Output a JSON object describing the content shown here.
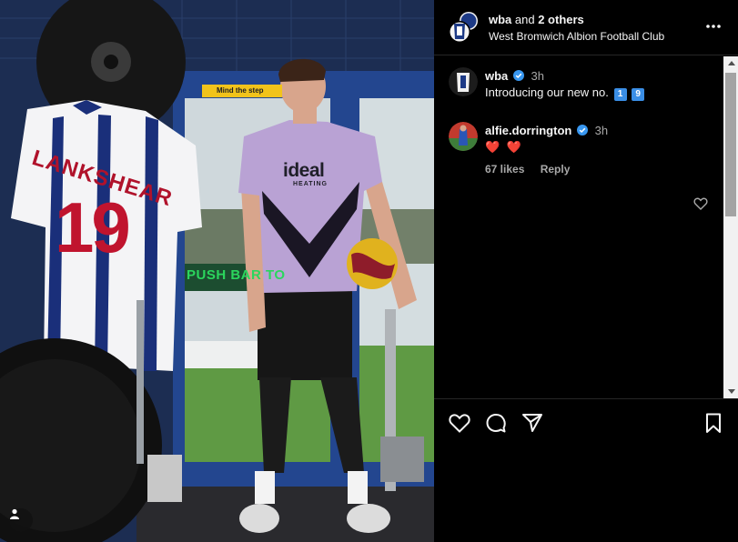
{
  "photo": {
    "jersey_name": "LANKSHEAR",
    "jersey_number": "19",
    "sign_step": "Mind the step",
    "sign_push": "PUSH BAR TO",
    "shirt_sponsor": "ideal",
    "shirt_sponsor_sub": "HEATING",
    "profile_icon": "person-icon"
  },
  "header": {
    "username": "wba",
    "and_text": " and ",
    "others": "2 others",
    "subtitle": "West Bromwich Albion Football Club",
    "more_icon": "more-horizontal-icon"
  },
  "comments": [
    {
      "username": "wba",
      "verified": true,
      "time": "3h",
      "text": "Introducing our new no.",
      "emoji": [
        "1",
        "9"
      ]
    },
    {
      "username": "alfie.dorrington",
      "verified": true,
      "time": "3h",
      "text": "❤️ ❤️",
      "likes": "67 likes",
      "reply": "Reply"
    }
  ],
  "actions": {
    "like": "heart-icon",
    "comment": "comment-icon",
    "share": "send-icon",
    "save": "bookmark-icon"
  },
  "colors": {
    "background": "#000000",
    "text": "#f5f5f5",
    "muted": "#a8a8a8",
    "verified": "#3897f0",
    "heart": "#e8283a"
  }
}
